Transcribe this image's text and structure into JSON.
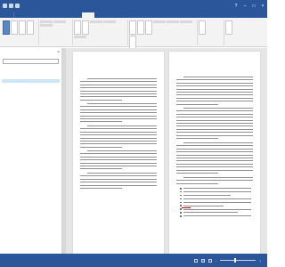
{
  "window": {
    "title": "",
    "accent_color": "#2b579a"
  },
  "ribbon": {
    "tabs": [
      {
        "label": "",
        "active": false
      },
      {
        "label": "",
        "active": false
      },
      {
        "label": "",
        "active": false
      },
      {
        "label": "",
        "active": false
      },
      {
        "label": "",
        "active": false
      },
      {
        "label": "",
        "active": false
      },
      {
        "label": "",
        "active": true
      },
      {
        "label": "",
        "active": false
      },
      {
        "label": "",
        "active": false
      },
      {
        "label": "",
        "active": false
      }
    ],
    "groups": [
      {
        "caption": ""
      },
      {
        "caption": ""
      },
      {
        "caption": ""
      },
      {
        "caption": ""
      },
      {
        "caption": ""
      },
      {
        "caption": ""
      }
    ]
  },
  "navigation": {
    "title": "",
    "search_placeholder": "",
    "views": [
      {
        "label": "",
        "active": true
      },
      {
        "label": "",
        "active": false
      },
      {
        "label": "",
        "active": false
      }
    ],
    "items": [
      {
        "label": "",
        "level": 1,
        "selected": false
      },
      {
        "label": "",
        "level": 2,
        "selected": true
      },
      {
        "label": "",
        "level": 2,
        "selected": false
      },
      {
        "label": "",
        "level": 2,
        "selected": false
      },
      {
        "label": "",
        "level": 2,
        "selected": false
      },
      {
        "label": "",
        "level": 2,
        "selected": false
      },
      {
        "label": "",
        "level": 2,
        "selected": false
      },
      {
        "label": "",
        "level": 1,
        "selected": false
      }
    ]
  },
  "document": {
    "page1": {
      "heading": ""
    },
    "page2": {
      "heading": ""
    }
  },
  "status": {
    "page": "",
    "words": "",
    "language": "",
    "zoom": ""
  }
}
